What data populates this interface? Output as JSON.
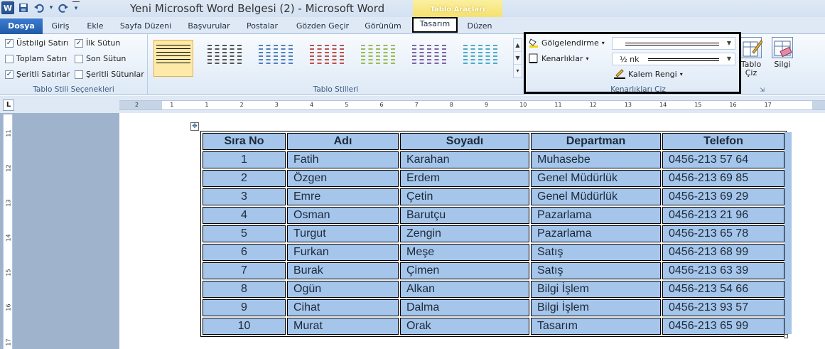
{
  "window": {
    "title": "Yeni Microsoft Word Belgesi (2)  -  Microsoft Word",
    "app_logo": "W",
    "contextual_header": "Tablo Araçları"
  },
  "qat": {
    "icons": [
      "save-icon",
      "undo-icon",
      "redo-icon",
      "customize-icon"
    ],
    "undo_caret": "▾",
    "customize_glyph": "▾"
  },
  "tabs": {
    "file": "Dosya",
    "items": [
      "Giriş",
      "Ekle",
      "Sayfa Düzeni",
      "Başvurular",
      "Postalar",
      "Gözden Geçir",
      "Görünüm",
      "Tasarım",
      "Düzen"
    ]
  },
  "ribbon": {
    "style_options": {
      "label": "Tablo Stili Seçenekleri",
      "items": [
        {
          "label": "Üstbilgi Satırı",
          "checked": true
        },
        {
          "label": "İlk Sütun",
          "checked": true
        },
        {
          "label": "Toplam Satırı",
          "checked": false
        },
        {
          "label": "Son Sütun",
          "checked": false
        },
        {
          "label": "Şeritli Satırlar",
          "checked": true
        },
        {
          "label": "Şeritli Sütunlar",
          "checked": false
        }
      ]
    },
    "table_styles": {
      "label": "Tablo Stilleri",
      "swatches": [
        "#000000",
        "#555555",
        "#4f81bd",
        "#c0504d",
        "#9bbb59",
        "#8064a2",
        "#4bacc6"
      ]
    },
    "borders": {
      "label": "Kenarlıkları Çiz",
      "shading": "Gölgelendirme",
      "borders_btn": "Kenarlıklar",
      "weight": "½ nk",
      "pen_color": "Kalem Rengi",
      "draw_table": "Tablo Çiz",
      "eraser": "Silgi"
    }
  },
  "ruler": {
    "marks": [
      "2",
      "1",
      "1",
      "2",
      "3",
      "4",
      "5",
      "6",
      "7",
      "8",
      "9",
      "10",
      "11",
      "12",
      "13",
      "14",
      "15",
      "16",
      "17"
    ],
    "vmarks": [
      "11",
      "12",
      "13",
      "14",
      "15",
      "16",
      "17"
    ]
  },
  "table": {
    "headers": [
      "Sıra No",
      "Adı",
      "Soyadı",
      "Departman",
      "Telefon"
    ],
    "rows": [
      [
        "1",
        "Fatih",
        "Karahan",
        "Muhasebe",
        "0456-213 57 64"
      ],
      [
        "2",
        "Özgen",
        "Erdem",
        "Genel Müdürlük",
        "0456-213 69 85"
      ],
      [
        "3",
        "Emre",
        "Çetin",
        "Genel Müdürlük",
        "0456-213 69 29"
      ],
      [
        "4",
        "Osman",
        "Barutçu",
        "Pazarlama",
        "0456-213 21 96"
      ],
      [
        "5",
        "Turgut",
        "Zengin",
        "Pazarlama",
        "0456-213 65 78"
      ],
      [
        "6",
        "Furkan",
        "Meşe",
        "Satış",
        "0456-213 68 99"
      ],
      [
        "7",
        "Burak",
        "Çimen",
        "Satış",
        "0456-213 63 39"
      ],
      [
        "8",
        "Ogün",
        "Alkan",
        "Bilgi İşlem",
        "0456-213 54 66"
      ],
      [
        "9",
        "Cihat",
        "Dalma",
        "Bilgi İşlem",
        "0456-213 93 57"
      ],
      [
        "10",
        "Murat",
        "Orak",
        "Tasarım",
        "0456-213 65 99"
      ]
    ]
  }
}
